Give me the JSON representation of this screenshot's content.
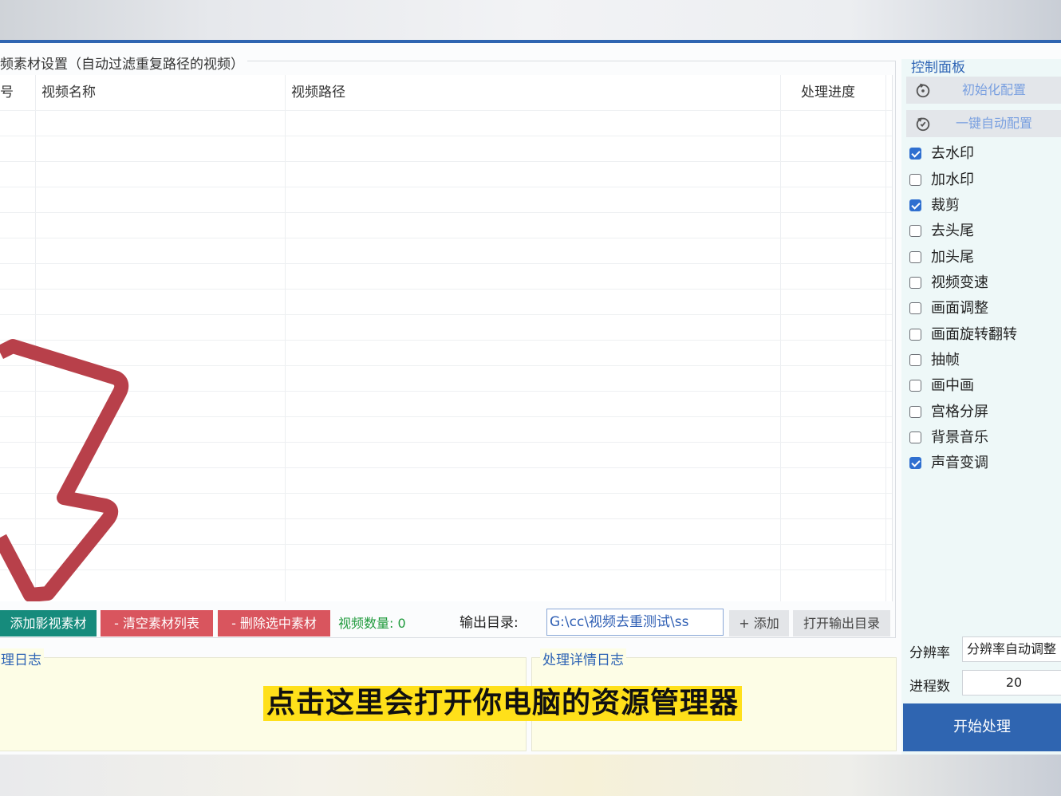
{
  "material_group": {
    "title": "频素材设置（自动过滤重复路径的视频）",
    "columns": [
      "号",
      "视频名称",
      "视频路径",
      "处理进度"
    ]
  },
  "buttons": {
    "add": "添加影视素材",
    "clear": "- 清空素材列表",
    "delete": "- 删除选中素材",
    "count_label": "视频数量: 0",
    "output_label": "输出目录:",
    "output_path": "G:\\cc\\视频去重测试\\ss",
    "add_dir": "+ 添加",
    "open_dir": "打开输出目录"
  },
  "logs": {
    "left_title": "理日志",
    "right_title": "处理详情日志"
  },
  "caption": "点击这里会打开你电脑的资源管理器",
  "panel": {
    "title": "控制面板",
    "init_button": "初始化配置",
    "auto_button": "一键自动配置",
    "options": [
      {
        "label": "去水印",
        "checked": true
      },
      {
        "label": "加水印",
        "checked": false
      },
      {
        "label": "裁剪",
        "checked": true
      },
      {
        "label": "去头尾",
        "checked": false
      },
      {
        "label": "加头尾",
        "checked": false
      },
      {
        "label": "视频变速",
        "checked": false
      },
      {
        "label": "画面调整",
        "checked": false
      },
      {
        "label": "画面旋转翻转",
        "checked": false
      },
      {
        "label": "抽帧",
        "checked": false
      },
      {
        "label": "画中画",
        "checked": false
      },
      {
        "label": "宫格分屏",
        "checked": false
      },
      {
        "label": "背景音乐",
        "checked": false
      },
      {
        "label": "声音变调",
        "checked": true
      }
    ],
    "resolution_label": "分辨率",
    "resolution_value": "分辨率自动调整",
    "process_label": "进程数",
    "process_value": "20",
    "start_button": "开始处理"
  },
  "colors": {
    "accent": "#2f65b1",
    "teal": "#168b7c",
    "red": "#d9555e",
    "log_bg": "#fdfde6",
    "caption_bg": "#ffe01a",
    "arrow": "#b8404a"
  }
}
